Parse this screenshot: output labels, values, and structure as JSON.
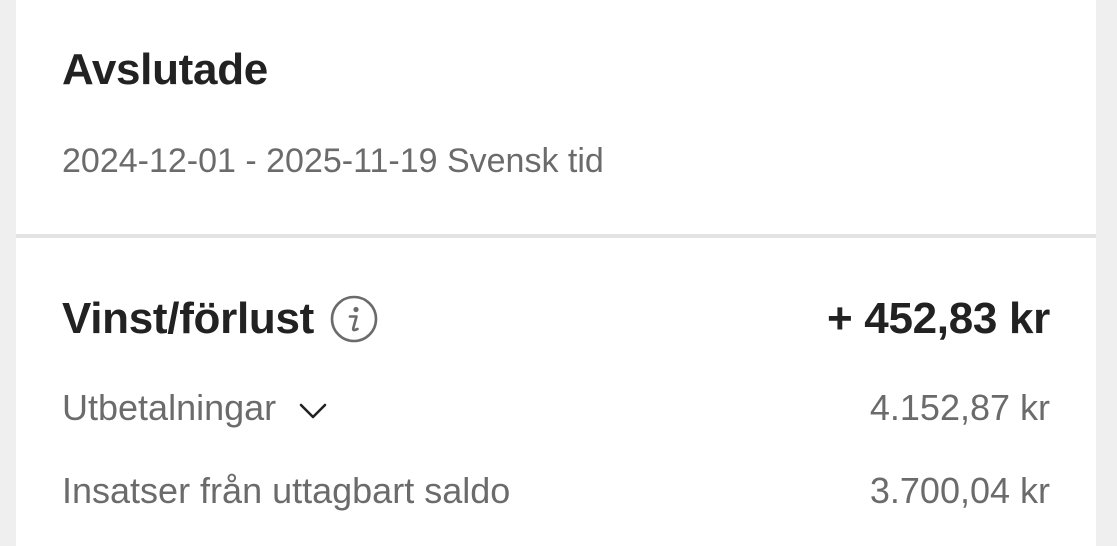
{
  "header": {
    "title": "Avslutade",
    "date_range": "2024-12-01 - 2025-11-19 Svensk tid"
  },
  "summary": {
    "profit_loss": {
      "label": "Vinst/förlust",
      "value": "+ 452,83 kr",
      "icon": "info-icon"
    },
    "rows": [
      {
        "label": "Utbetalningar",
        "value": "4.152,87 kr",
        "icon": "chevron-down-icon"
      },
      {
        "label": "Insatser från uttagbart saldo",
        "value": "3.700,04 kr"
      }
    ]
  },
  "colors": {
    "background": "#efefef",
    "card": "#ffffff",
    "primary_text": "#222222",
    "secondary_text": "#6b6b6b",
    "divider": "#e3e3e3"
  }
}
